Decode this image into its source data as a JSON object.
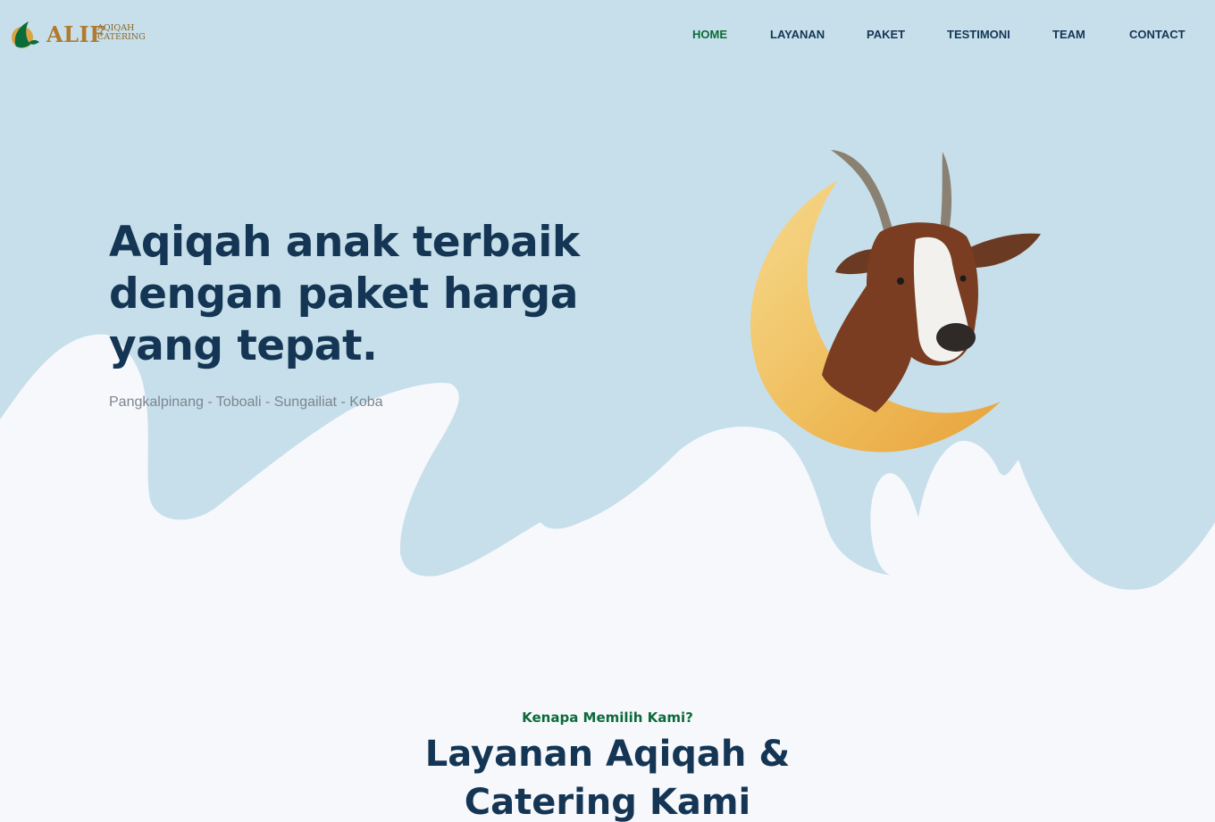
{
  "brand": {
    "name": "ALIF",
    "tagline_line1": "AQIQAH",
    "tagline_line2": "CATERING",
    "colors": {
      "primary": "#143654",
      "accent": "#0b6b3a",
      "gold": "#b07a2f",
      "hero_bg": "#c6dfea"
    }
  },
  "nav": {
    "items": [
      {
        "label": "HOME",
        "active": true
      },
      {
        "label": "LAYANAN",
        "active": false
      },
      {
        "label": "PAKET",
        "active": false
      },
      {
        "label": "TESTIMONI",
        "active": false
      },
      {
        "label": "TEAM",
        "active": false
      },
      {
        "label": "CONTACT",
        "active": false
      }
    ]
  },
  "hero": {
    "title": "Aqiqah anak terbaik dengan paket harga yang tepat.",
    "subtitle": "Pangkalpinang - Toboali - Sungailiat - Koba",
    "illustration": "crescent-moon-goat"
  },
  "section": {
    "kicker": "Kenapa Memilih Kami?",
    "title": "Layanan Aqiqah & Catering Kami"
  }
}
